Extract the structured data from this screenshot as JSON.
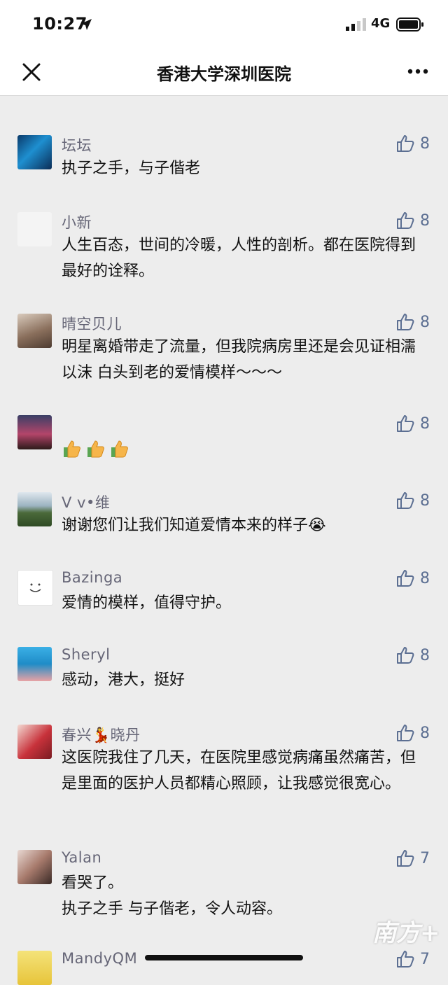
{
  "status": {
    "time": "10:27",
    "network": "4G"
  },
  "nav": {
    "title": "香港大学深圳医院"
  },
  "comments": [
    {
      "name": "坛坛",
      "text": "执子之手，与子偕老",
      "likes": "8"
    },
    {
      "name": "小新",
      "text": "人生百态，世间的冷暖，人性的剖析。都在医院得到最好的诠释。",
      "likes": "8"
    },
    {
      "name": "晴空贝儿",
      "text": "明星离婚带走了流量，但我院病房里还是会见证相濡以沫 白头到老的爱情模样～～～",
      "likes": "8"
    },
    {
      "name": "",
      "text": "",
      "likes": "8"
    },
    {
      "name": "V v•维",
      "text": "谢谢您们让我们知道爱情本来的样子😭",
      "likes": "8"
    },
    {
      "name": "Bazinga",
      "text": "爱情的模样，值得守护。",
      "likes": "8"
    },
    {
      "name": "Sheryl",
      "text": "感动，港大，挺好",
      "likes": "8"
    },
    {
      "name": "春兴💃晓丹",
      "text": "这医院我住了几天，在医院里感觉病痛虽然痛苦，但是里面的医护人员都精心照顾，让我感觉很宽心。",
      "likes": "8"
    },
    {
      "name": "Yalan",
      "text_line1": "看哭了。",
      "text_line2": "执子之手 与子偕老，令人动容。",
      "likes": "7"
    },
    {
      "name": "MandyQM",
      "likes": "7"
    }
  ],
  "watermark": "南方+",
  "colors": {
    "like": "#5c6f92",
    "name": "#666677",
    "background": "#ededed"
  }
}
